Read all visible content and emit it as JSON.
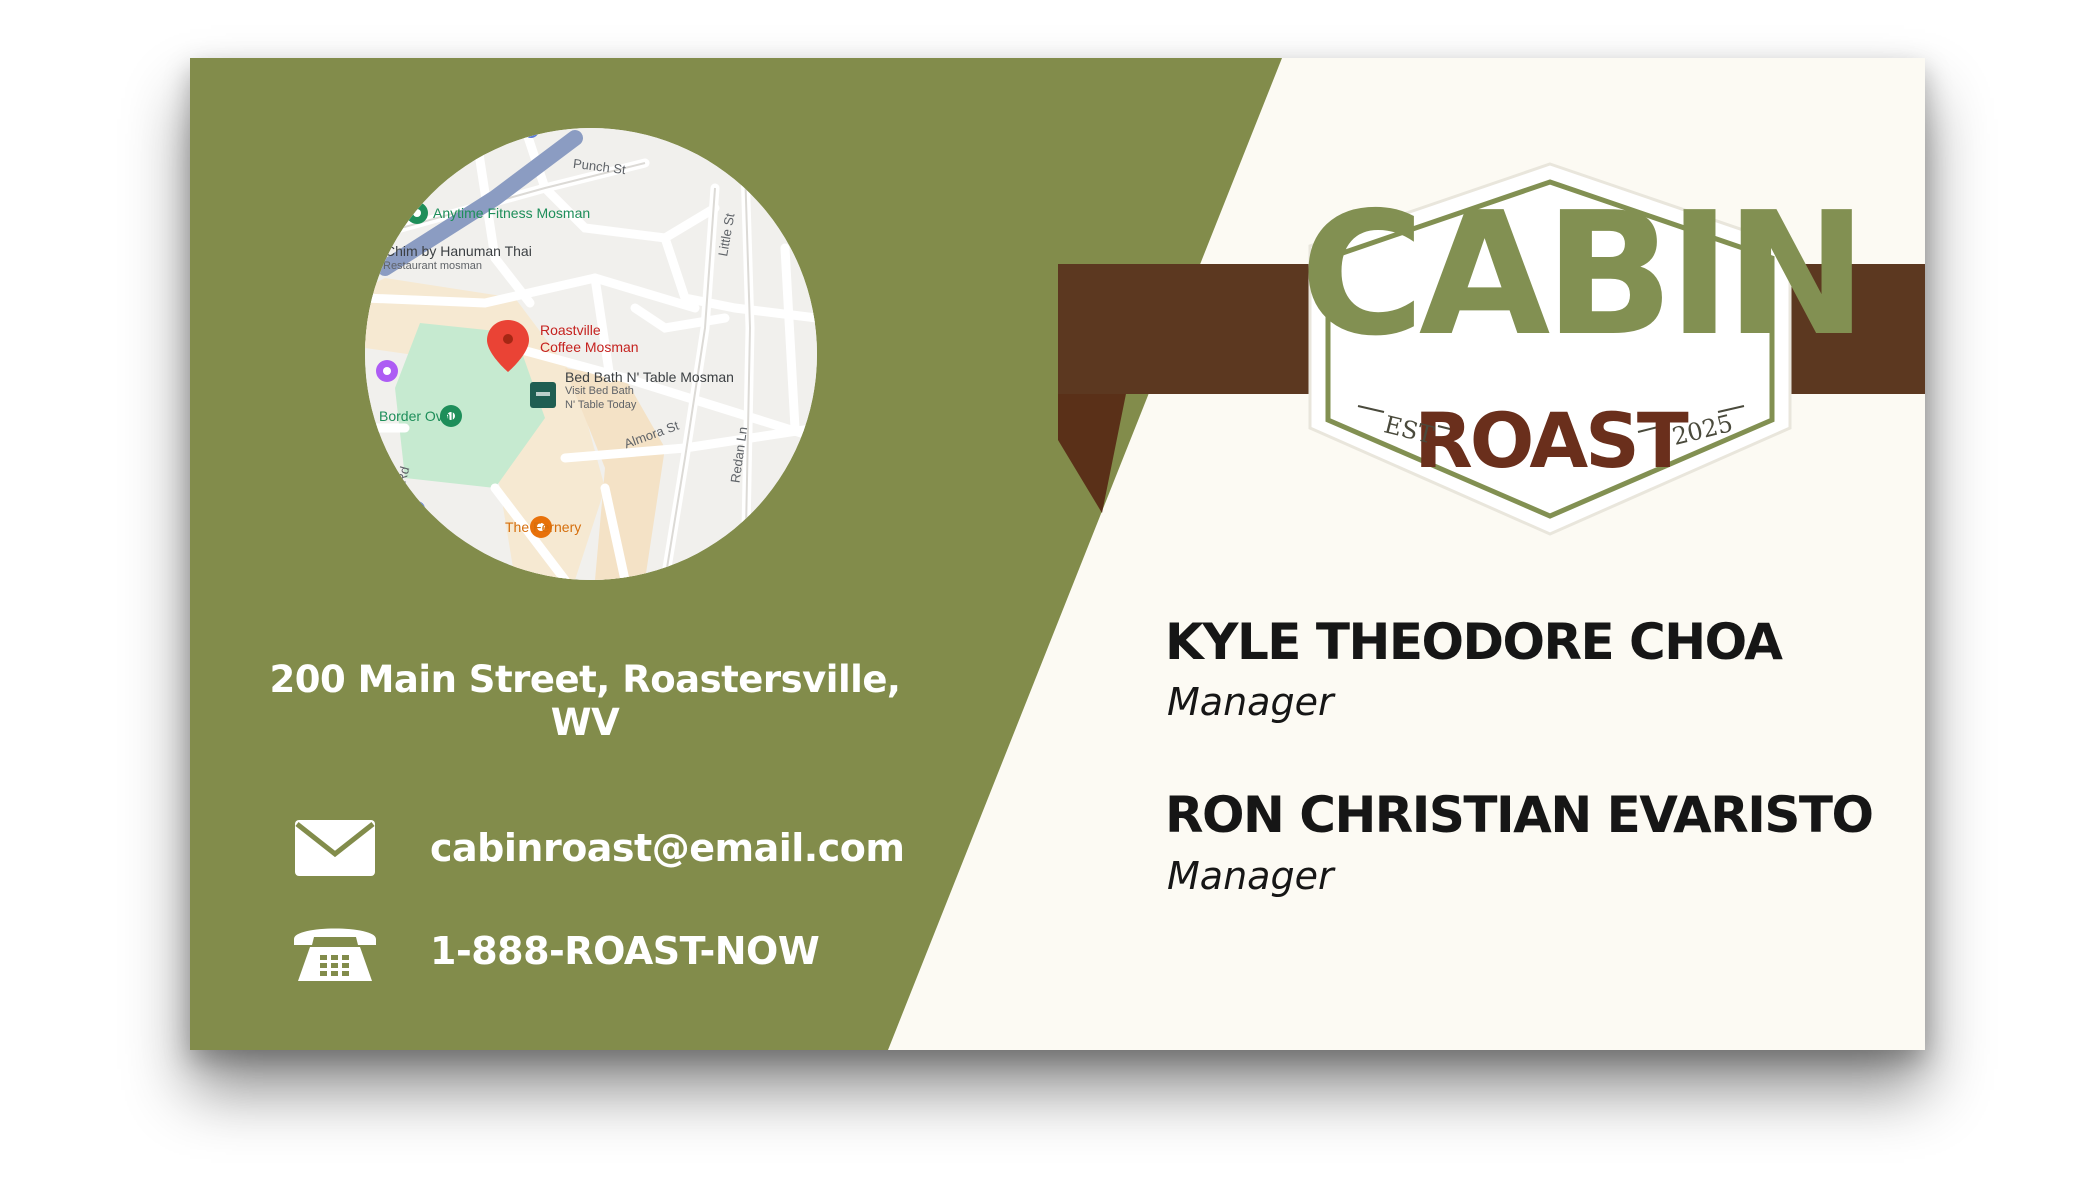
{
  "card": {
    "address": "200 Main Street, Roastersville, WV",
    "email": "cabinroast@email.com",
    "phone": "1-888-ROAST-NOW",
    "icons": {
      "email": "envelope-icon",
      "phone": "telephone-icon"
    },
    "colors": {
      "olive": "#828c4b",
      "brown": "#5c3820",
      "cream": "#fcfaf3"
    }
  },
  "logo": {
    "word_top": "CABIN",
    "word_bottom": "ROAST",
    "est": "EST",
    "year": "2025"
  },
  "people": [
    {
      "name": "KYLE THEODORE CHOA",
      "role": "Manager"
    },
    {
      "name": "RON CHRISTIAN EVARISTO",
      "role": "Manager"
    }
  ],
  "map": {
    "labels": {
      "punch_st": "Punch St",
      "anytime_fitness": "Anytime Fitness Mosman",
      "chim_thai": "Chim by Hanuman Thai",
      "restaurant_mosman": "Restaurant mosman",
      "little_st": "Little St",
      "roastville": "Roastville",
      "coffee_mosman": "Coffee Mosman",
      "bed_bath": "Bed Bath N' Table Mosman",
      "visit_bed_bath": "Visit Bed Bath",
      "table_today": "N' Table Today",
      "border_oval": "Border Oval",
      "almora_st": "Almora St",
      "redan_ln": "Redan Ln",
      "rd": "Rd",
      "the_fernery": "The Fernery"
    }
  }
}
